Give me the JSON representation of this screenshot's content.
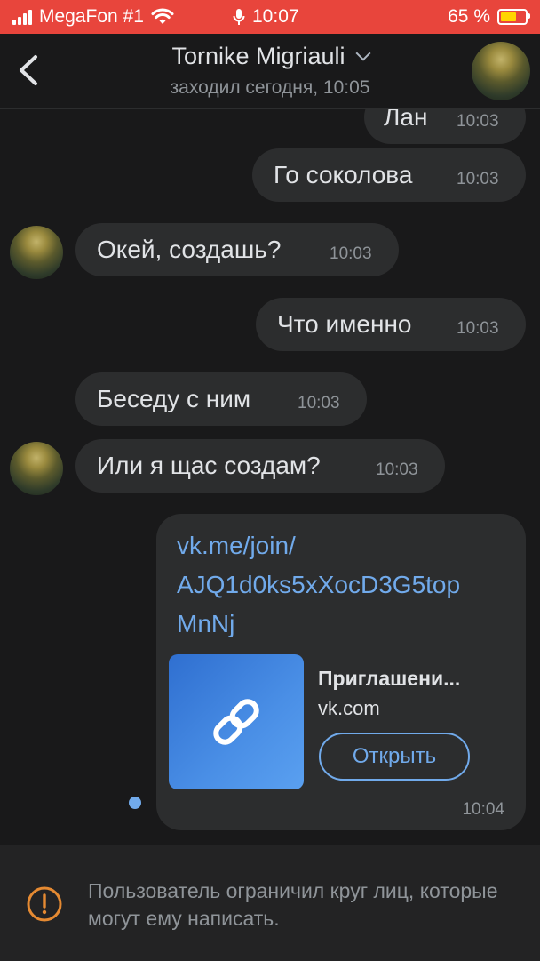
{
  "status_bar": {
    "carrier": "MegaFon #1",
    "time": "10:07",
    "battery": "65 %",
    "battery_level": 0.65
  },
  "header": {
    "title": "Tornike Migriauli",
    "subtitle": "заходил сегодня, 10:05"
  },
  "messages": [
    {
      "text": "Лан",
      "time": "10:03",
      "direction": "outgoing"
    },
    {
      "text": "Го соколова",
      "time": "10:03",
      "direction": "outgoing"
    },
    {
      "text": "Окей, создашь?",
      "time": "10:03",
      "direction": "incoming"
    },
    {
      "text": "Что именно",
      "time": "10:03",
      "direction": "outgoing"
    },
    {
      "text": "Беседу с ним",
      "time": "10:03",
      "direction": "incoming"
    },
    {
      "text": "Или я щас создам?",
      "time": "10:03",
      "direction": "incoming"
    }
  ],
  "link_message": {
    "url_lines": [
      "vk.me/join/",
      "AJQ1d0ks5xXocD3G5top",
      "MnNj"
    ],
    "preview_title": "Приглашени...",
    "preview_domain": "vk.com",
    "open_button": "Открыть",
    "time": "10:04"
  },
  "notice": {
    "text": "Пользователь ограничил круг лиц, которые могут ему написать."
  },
  "colors": {
    "status_bar": "#e8453c",
    "background": "#19191a",
    "bubble": "#2c2d2e",
    "accent": "#71aaeb",
    "warning": "#e58a32"
  },
  "icons": [
    "signal-icon",
    "wifi-icon",
    "mic-icon",
    "battery-icon",
    "back-arrow-icon",
    "chevron-down-icon",
    "link-icon",
    "warning-icon"
  ]
}
